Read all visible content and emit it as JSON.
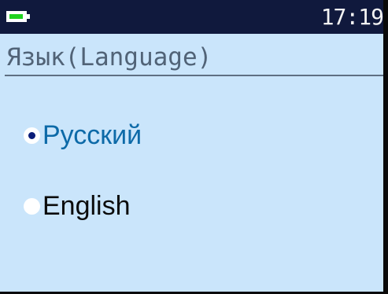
{
  "status_bar": {
    "battery_icon": "battery-icon",
    "battery_level": 0.85,
    "battery_color": "#1fd21f",
    "time": "17:19"
  },
  "screen": {
    "title": "Язык(Language)"
  },
  "options": [
    {
      "label": "Русский",
      "selected": true,
      "color": "#0d6aa8"
    },
    {
      "label": "English",
      "selected": false,
      "color": "#0b0b0b"
    }
  ],
  "colors": {
    "background": "#cae5fb",
    "status_bar": "#10193d",
    "title": "#516377",
    "radio_dot": "#0a1c78"
  }
}
